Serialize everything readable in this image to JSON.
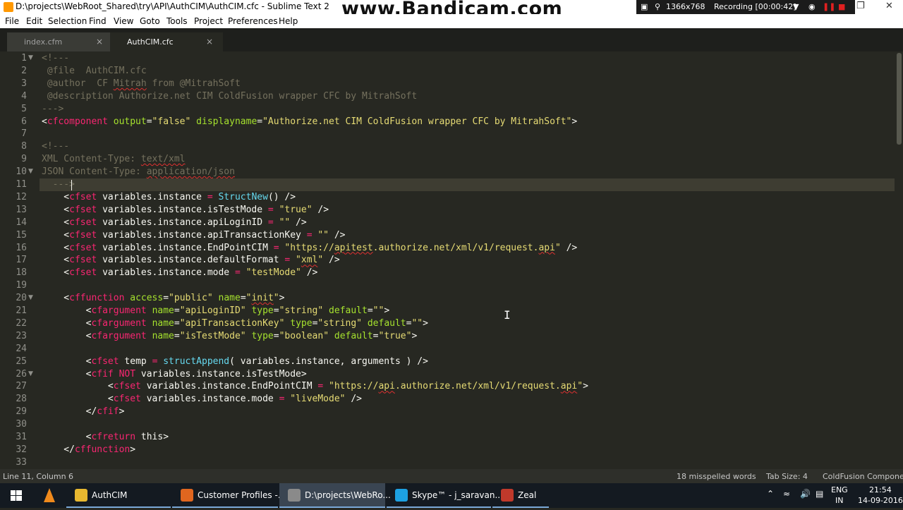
{
  "window": {
    "title": "D:\\projects\\WebRoot_Shared\\try\\API\\AuthCIM\\AuthCIM.cfc - Sublime Text 2",
    "watermark": "www.Bandicam.com",
    "recorder_resolution": "1366x768",
    "recorder_status": "Recording [00:00:42]",
    "minimize": "–",
    "restore": "❐",
    "close": "✕"
  },
  "menu": [
    "File",
    "Edit",
    "Selection",
    "Find",
    "View",
    "Goto",
    "Tools",
    "Project",
    "Preferences",
    "Help"
  ],
  "tabs": [
    {
      "label": "index.cfm",
      "close": "×",
      "active": false
    },
    {
      "label": "AuthCIM.cfc",
      "close": "×",
      "active": true
    }
  ],
  "editor": {
    "current_line": 11,
    "lines": [
      {
        "n": "1",
        "fold": "▼",
        "html": "<span class='c'>&lt;!---</span>"
      },
      {
        "n": "2",
        "fold": "",
        "html": "<span class='c'> @file  AuthCIM.cfc</span>"
      },
      {
        "n": "3",
        "fold": "",
        "html": "<span class='c'> @author  CF <span class='sq'>Mitrah</span> from @MitrahSoft</span>"
      },
      {
        "n": "4",
        "fold": "",
        "html": "<span class='c'> @description Authorize.net CIM ColdFusion wrapper CFC by MitrahSoft</span>"
      },
      {
        "n": "5",
        "fold": "",
        "html": "<span class='c'>---&gt;</span>"
      },
      {
        "n": "6",
        "fold": "",
        "html": "&lt;<span class='tg'>cfcomponent</span> <span class='at'>output</span>=<span class='st'>\"false\"</span> <span class='at'>displayname</span>=<span class='st'>\"Authorize.net CIM ColdFusion wrapper CFC by MitrahSoft\"</span>&gt;"
      },
      {
        "n": "7",
        "fold": "",
        "html": ""
      },
      {
        "n": "8",
        "fold": "",
        "html": "<span class='c'>&lt;!---</span>"
      },
      {
        "n": "9",
        "fold": "",
        "html": "<span class='c'>XML Content-Type: <span class='sq'>text/xml</span></span>"
      },
      {
        "n": "10",
        "fold": "▼",
        "html": "<span class='c'>JSON Content-Type: <span class='sq'>application/json</span></span>"
      },
      {
        "n": "11",
        "fold": "",
        "html": "<span class='c'>  ---&gt;</span>"
      },
      {
        "n": "12",
        "fold": "",
        "html": "    &lt;<span class='tg'>cfset</span> variables.instance <span class='tg'>=</span> <span class='fn'>StructNew</span>() /&gt;"
      },
      {
        "n": "13",
        "fold": "",
        "html": "    &lt;<span class='tg'>cfset</span> variables.instance.isTestMode <span class='tg'>=</span> <span class='st'>\"true\"</span> /&gt;"
      },
      {
        "n": "14",
        "fold": "",
        "html": "    &lt;<span class='tg'>cfset</span> variables.instance.apiLoginID <span class='tg'>=</span> <span class='st'>\"\"</span> /&gt;"
      },
      {
        "n": "15",
        "fold": "",
        "html": "    &lt;<span class='tg'>cfset</span> variables.instance.apiTransactionKey <span class='tg'>=</span> <span class='st'>\"\"</span> /&gt;"
      },
      {
        "n": "16",
        "fold": "",
        "html": "    &lt;<span class='tg'>cfset</span> variables.instance.EndPointCIM <span class='tg'>=</span> <span class='st'>\"https://<span class='sq'>apitest</span>.authorize.net/xml/v1/request.<span class='sq'>api</span>\"</span> /&gt;"
      },
      {
        "n": "17",
        "fold": "",
        "html": "    &lt;<span class='tg'>cfset</span> variables.instance.defaultFormat <span class='tg'>=</span> <span class='st'>\"<span class='sq'>xml</span>\"</span> /&gt;"
      },
      {
        "n": "18",
        "fold": "",
        "html": "    &lt;<span class='tg'>cfset</span> variables.instance.mode <span class='tg'>=</span> <span class='st'>\"testMode\"</span> /&gt;"
      },
      {
        "n": "19",
        "fold": "",
        "html": ""
      },
      {
        "n": "20",
        "fold": "▼",
        "html": "    &lt;<span class='tg'>cffunction</span> <span class='at'>access</span>=<span class='st'>\"public\"</span> <span class='at'>name</span>=<span class='st'>\"<span class='sq'>init</span>\"</span>&gt;"
      },
      {
        "n": "21",
        "fold": "",
        "html": "        &lt;<span class='tg'>cfargument</span> <span class='at'>name</span>=<span class='st'>\"apiLoginID\"</span> <span class='at'>type</span>=<span class='st'>\"string\"</span> <span class='at'>default</span>=<span class='st'>\"\"</span>&gt;"
      },
      {
        "n": "22",
        "fold": "",
        "html": "        &lt;<span class='tg'>cfargument</span> <span class='at'>name</span>=<span class='st'>\"apiTransactionKey\"</span> <span class='at'>type</span>=<span class='st'>\"string\"</span> <span class='at'>default</span>=<span class='st'>\"\"</span>&gt;"
      },
      {
        "n": "23",
        "fold": "",
        "html": "        &lt;<span class='tg'>cfargument</span> <span class='at'>name</span>=<span class='st'>\"isTestMode\"</span> <span class='at'>type</span>=<span class='st'>\"boolean\"</span> <span class='at'>default</span>=<span class='st'>\"true\"</span>&gt;"
      },
      {
        "n": "24",
        "fold": "",
        "html": ""
      },
      {
        "n": "25",
        "fold": "",
        "html": "        &lt;<span class='tg'>cfset</span> temp <span class='tg'>=</span> <span class='fn'>structAppend</span>( variables.instance, arguments ) /&gt;"
      },
      {
        "n": "26",
        "fold": "▼",
        "html": "        &lt;<span class='tg'>cfif</span> <span class='tg'>NOT</span> variables.instance.isTestMode&gt;"
      },
      {
        "n": "27",
        "fold": "",
        "html": "            &lt;<span class='tg'>cfset</span> variables.instance.EndPointCIM <span class='tg'>=</span> <span class='st'>\"https://<span class='sq'>api</span>.authorize.net/xml/v1/request.<span class='sq'>api</span>\"</span>&gt;"
      },
      {
        "n": "28",
        "fold": "",
        "html": "            &lt;<span class='tg'>cfset</span> variables.instance.mode <span class='tg'>=</span> <span class='st'>\"liveMode\"</span> /&gt;"
      },
      {
        "n": "29",
        "fold": "",
        "html": "        &lt;/<span class='tg'>cfif</span>&gt;"
      },
      {
        "n": "30",
        "fold": "",
        "html": ""
      },
      {
        "n": "31",
        "fold": "",
        "html": "        &lt;<span class='tg'>cfreturn</span> this&gt;"
      },
      {
        "n": "32",
        "fold": "",
        "html": "    &lt;/<span class='tg'>cffunction</span>&gt;"
      },
      {
        "n": "33",
        "fold": "",
        "html": ""
      }
    ]
  },
  "status": {
    "position": "Line 11, Column 6",
    "spell": "18 misspelled words",
    "tab_size": "Tab Size: 4",
    "syntax": "ColdFusion Component"
  },
  "taskbar": {
    "items": [
      {
        "label": "AuthCIM",
        "color": "#e8b830",
        "active": false
      },
      {
        "label": "Customer Profiles -...",
        "color": "#e0661f",
        "active": false
      },
      {
        "label": "D:\\projects\\WebRo...",
        "color": "#8a8a8a",
        "active": true
      },
      {
        "label": "Skype™ - j_saravan...",
        "color": "#1da1e2",
        "active": false
      },
      {
        "label": "Zeal",
        "color": "#c0392b",
        "active": false
      }
    ],
    "lang": "ENG",
    "region": "IN",
    "time": "21:54",
    "date": "14-09-2016"
  }
}
